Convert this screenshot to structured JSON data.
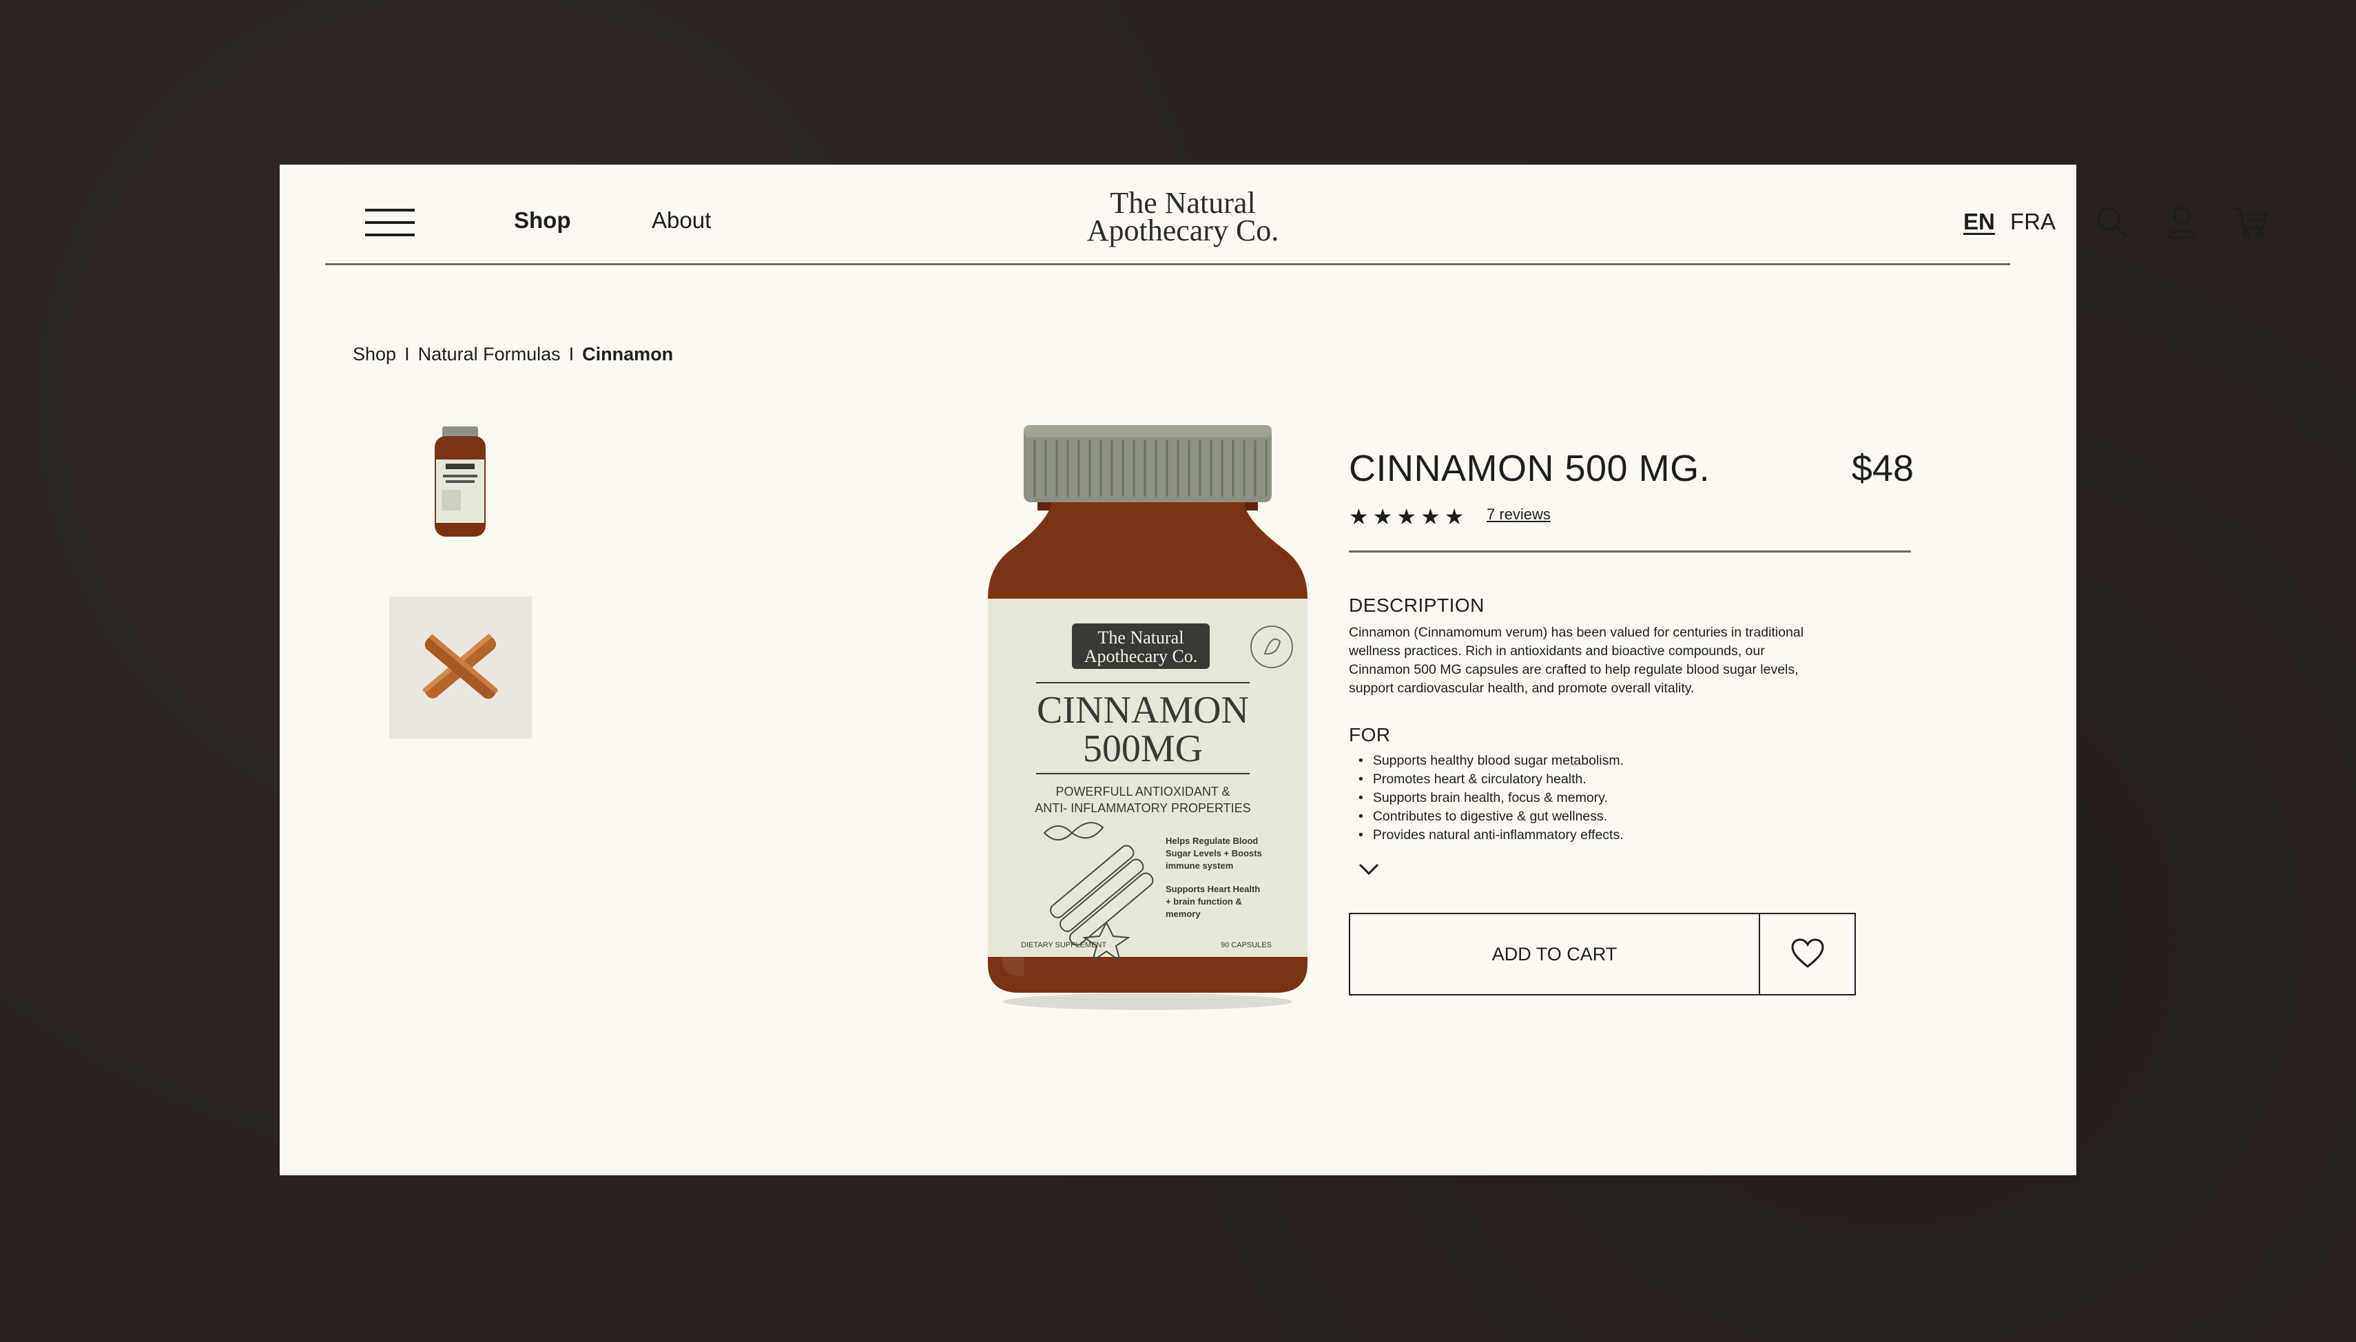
{
  "header": {
    "nav": {
      "shop": "Shop",
      "about": "About"
    },
    "logo": {
      "line1": "The Natural",
      "line2": "Apothecary Co."
    },
    "languages": [
      "EN",
      "FRA"
    ],
    "active_language": "EN",
    "icons": [
      "menu-icon",
      "search-icon",
      "user-icon",
      "cart-icon"
    ]
  },
  "breadcrumb": {
    "items": [
      "Shop",
      "Natural Formulas",
      "Cinnamon"
    ],
    "separator": "I"
  },
  "gallery": {
    "thumbnails": [
      "bottle-thumbnail",
      "cinnamon-sticks-thumbnail"
    ],
    "label": {
      "brand_line1": "The Natural",
      "brand_line2": "Apothecary Co.",
      "name_line1": "CINNAMON",
      "name_line2": "500MG",
      "tagline_line1": "POWERFULL ANTIOXIDANT &",
      "tagline_line2": "ANTI- INFLAMMATORY PROPERTIES",
      "benefit1_line1": "Helps Regulate Blood",
      "benefit1_line2": "Sugar Levels + Boosts",
      "benefit1_line3": "immune system",
      "benefit2_line1": "Supports Heart Health",
      "benefit2_line2": "+ brain function &",
      "benefit2_line3": "memory",
      "footer_left": "DIETARY SUPPLEMENT",
      "footer_right": "90 CAPSULES"
    }
  },
  "product": {
    "title": "CINNAMON 500 MG.",
    "price": "$48",
    "stars": "★★★★★",
    "rating": 5,
    "reviews": "7 reviews",
    "description_heading": "DESCRIPTION",
    "description_lines": [
      "Cinnamon (Cinnamomum verum) has been valued for centuries in traditional",
      "wellness practices. Rich in antioxidants and bioactive compounds, our",
      "Cinnamon 500 MG capsules are crafted to help regulate blood sugar levels,",
      "support cardiovascular health, and promote overall vitality."
    ],
    "for_heading": "FOR",
    "for_items": [
      "Supports healthy blood sugar metabolism.",
      "Promotes heart & circulatory health.",
      "Supports brain health, focus & memory.",
      "Contributes to digestive & gut wellness.",
      "Provides natural anti-inflammatory effects."
    ],
    "add_to_cart": "ADD TO CART",
    "wishlist_icon": "heart-icon"
  },
  "colors": {
    "background": "#2a2321",
    "page": "#fbf9f1",
    "text": "#1e1e1e",
    "bottle_amber": "#7a3414",
    "bottle_cap": "#8c9183",
    "label": "#e6e7d8",
    "cinnamon": "#b5662b"
  }
}
